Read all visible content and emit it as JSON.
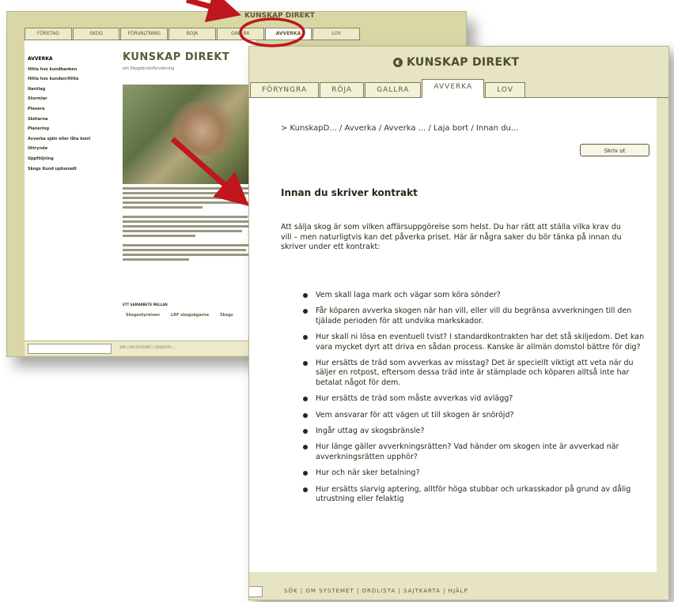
{
  "back_page": {
    "title": "KUNSKAP DIREKT",
    "tabs": [
      "FÖRETAG",
      "SKOG",
      "FÖRVALTNING",
      "BOJA",
      "GALLRA",
      "AVVERKA",
      "LOV"
    ],
    "active_tab_index": 5,
    "sidebar": [
      "AVVERKA",
      "Hitta hos kundbanken",
      "Hitta hos kunden/Hitta",
      "Hantlag",
      "Stormlar",
      "Planera",
      "Skötarna",
      "Planering",
      "Avverka själv eller låta kont?",
      "Uttrynde",
      "Uppföljning",
      "Skogs Kund upbunadt"
    ],
    "brand": "KUNSKAP DIREKT",
    "subtitle": "om Skogsbruksförvaltning",
    "sponsor_label": "ETT SAMARBETE MELLAN",
    "sponsor_logos": [
      "Skogsstyrelsen",
      "LRF skogsägarna",
      "Skogs"
    ],
    "footer_links": "SÖK | OM SYSTEMET | ORDLISTA | ..."
  },
  "front_page": {
    "brand": "KUNSKAP DIREKT",
    "tabs": [
      "FÖRYNGRA",
      "RÖJA",
      "GALLRA",
      "AVVERKA",
      "LOV"
    ],
    "active_tab_index": 3,
    "breadcrumb": "> KunskapD... / Avverka / Avverka ... / Laja bort / Innan du...",
    "print_button": "Skriv ut",
    "heading": "Innan du skriver kontrakt",
    "intro": "Att sälja skog är som vilken affärsuppgörelse som helst. Du har rätt att ställa vilka krav du vill – men naturligtvis kan det påverka priset. Här är några saker du bör tänka på innan du skriver under ett kontrakt:",
    "bullets": [
      "Vem skall laga mark och vägar som köra sönder?",
      "Får köparen avverka skogen när han vill, eller vill du begränsa avverkningen till den tjälade perioden för att undvika markskador.",
      "Hur skall ni lösa en eventuell tvist? I standardkontrakten har det stå skiljedom. Det kan vara mycket dyrt att driva en sådan process. Kanske är allmän domstol bättre för dig?",
      "Hur ersätts de träd som avverkas av misstag? Det är speciellt viktigt att veta när du säljer en rotpost, eftersom dessa träd inte är stämplade och köparen alltså inte har betalat något för dem.",
      "Hur ersätts de träd som måste avverkas vid avlägg?",
      "Vem ansvarar för att vägen ut till skogen är snöröjd?",
      "Ingår uttag av skogsbränsle?",
      "Hur länge gäller avverkningsrätten? Vad händer om skogen inte är avverkad när avverkningsrätten upphör?",
      "Hur och när sker betalning?",
      "Hur ersätts slarvig aptering, alltför höga stubbar och urkasskador på grund av dålig utrustning eller felaktig"
    ],
    "footer_links": "SÖK | OM SYSTEMET | ORDLISTA | SAJTKARTA | HJÄLP"
  },
  "annotation_color": "#c0161d"
}
